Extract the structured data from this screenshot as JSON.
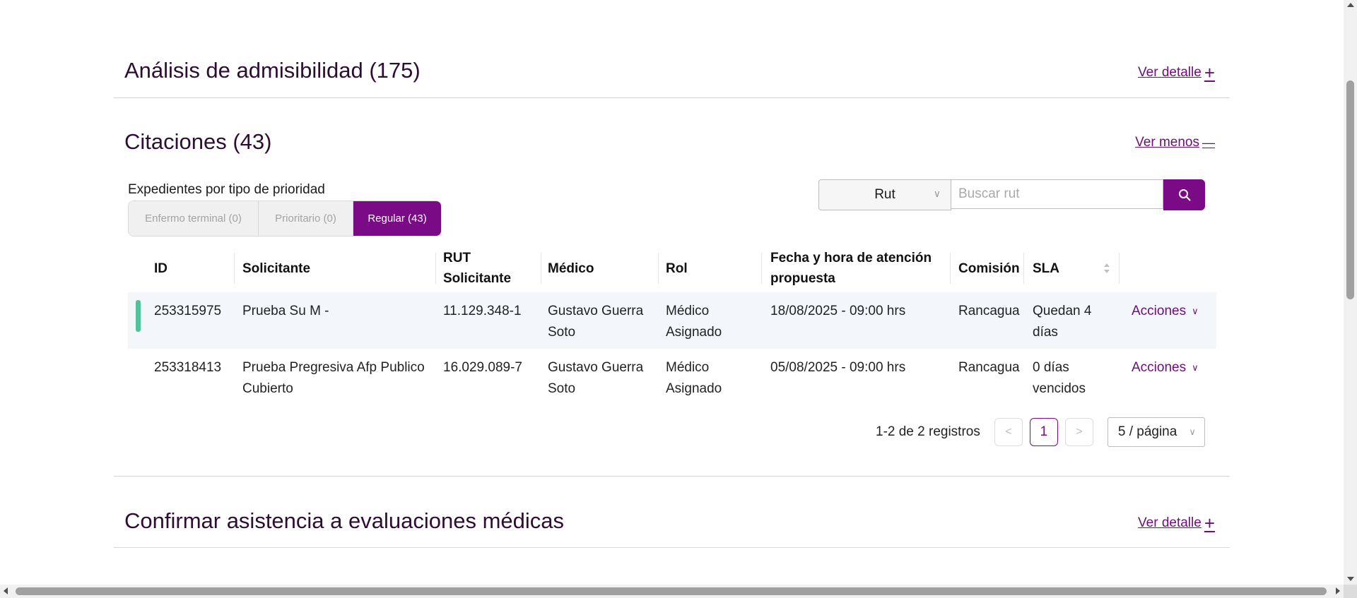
{
  "sections": {
    "admisibilidad": {
      "title": "Análisis de admisibilidad (175)",
      "link": "Ver detalle",
      "sign": "+"
    },
    "citaciones": {
      "title": "Citaciones (43)",
      "link": "Ver menos",
      "sign": "—"
    },
    "confirmar": {
      "title": "Confirmar asistencia a evaluaciones médicas",
      "link": "Ver detalle",
      "sign": "+"
    }
  },
  "priority": {
    "label": "Expedientes por tipo de prioridad",
    "tabs": [
      {
        "label": "Enfermo terminal (0)",
        "active": false
      },
      {
        "label": "Prioritario (0)",
        "active": false
      },
      {
        "label": "Regular (43)",
        "active": true
      }
    ]
  },
  "search": {
    "select_value": "Rut",
    "placeholder": "Buscar rut",
    "icon": "search-icon"
  },
  "table": {
    "columns": [
      "ID",
      "Solicitante",
      "RUT Solicitante",
      "Médico",
      "Rol",
      "Fecha y hora de atención propuesta",
      "Comisión",
      "SLA"
    ],
    "rows": [
      {
        "id": "253315975",
        "solicitante": "Prueba Su M -",
        "rut": "11.129.348-1",
        "medico": "Gustavo Guerra Soto",
        "rol": "Médico Asignado",
        "fecha": "18/08/2025 - 09:00 hrs",
        "comision": "Rancagua",
        "sla": "Quedan 4 días",
        "action": "Acciones",
        "status_color": "#52c29a"
      },
      {
        "id": "253318413",
        "solicitante": "Prueba Pregresiva Afp Publico Cubierto",
        "rut": "16.029.089-7",
        "medico": "Gustavo Guerra Soto",
        "rol": "Médico Asignado",
        "fecha": "05/08/2025 - 09:00 hrs",
        "comision": "Rancagua",
        "sla": "0 días vencidos",
        "action": "Acciones"
      }
    ]
  },
  "pagination": {
    "summary": "1-2 de 2 registros",
    "current_page": "1",
    "page_size": "5 / página"
  },
  "colors": {
    "accent": "#7a0a85",
    "link": "#6e0c7a",
    "status_green": "#52c29a"
  }
}
